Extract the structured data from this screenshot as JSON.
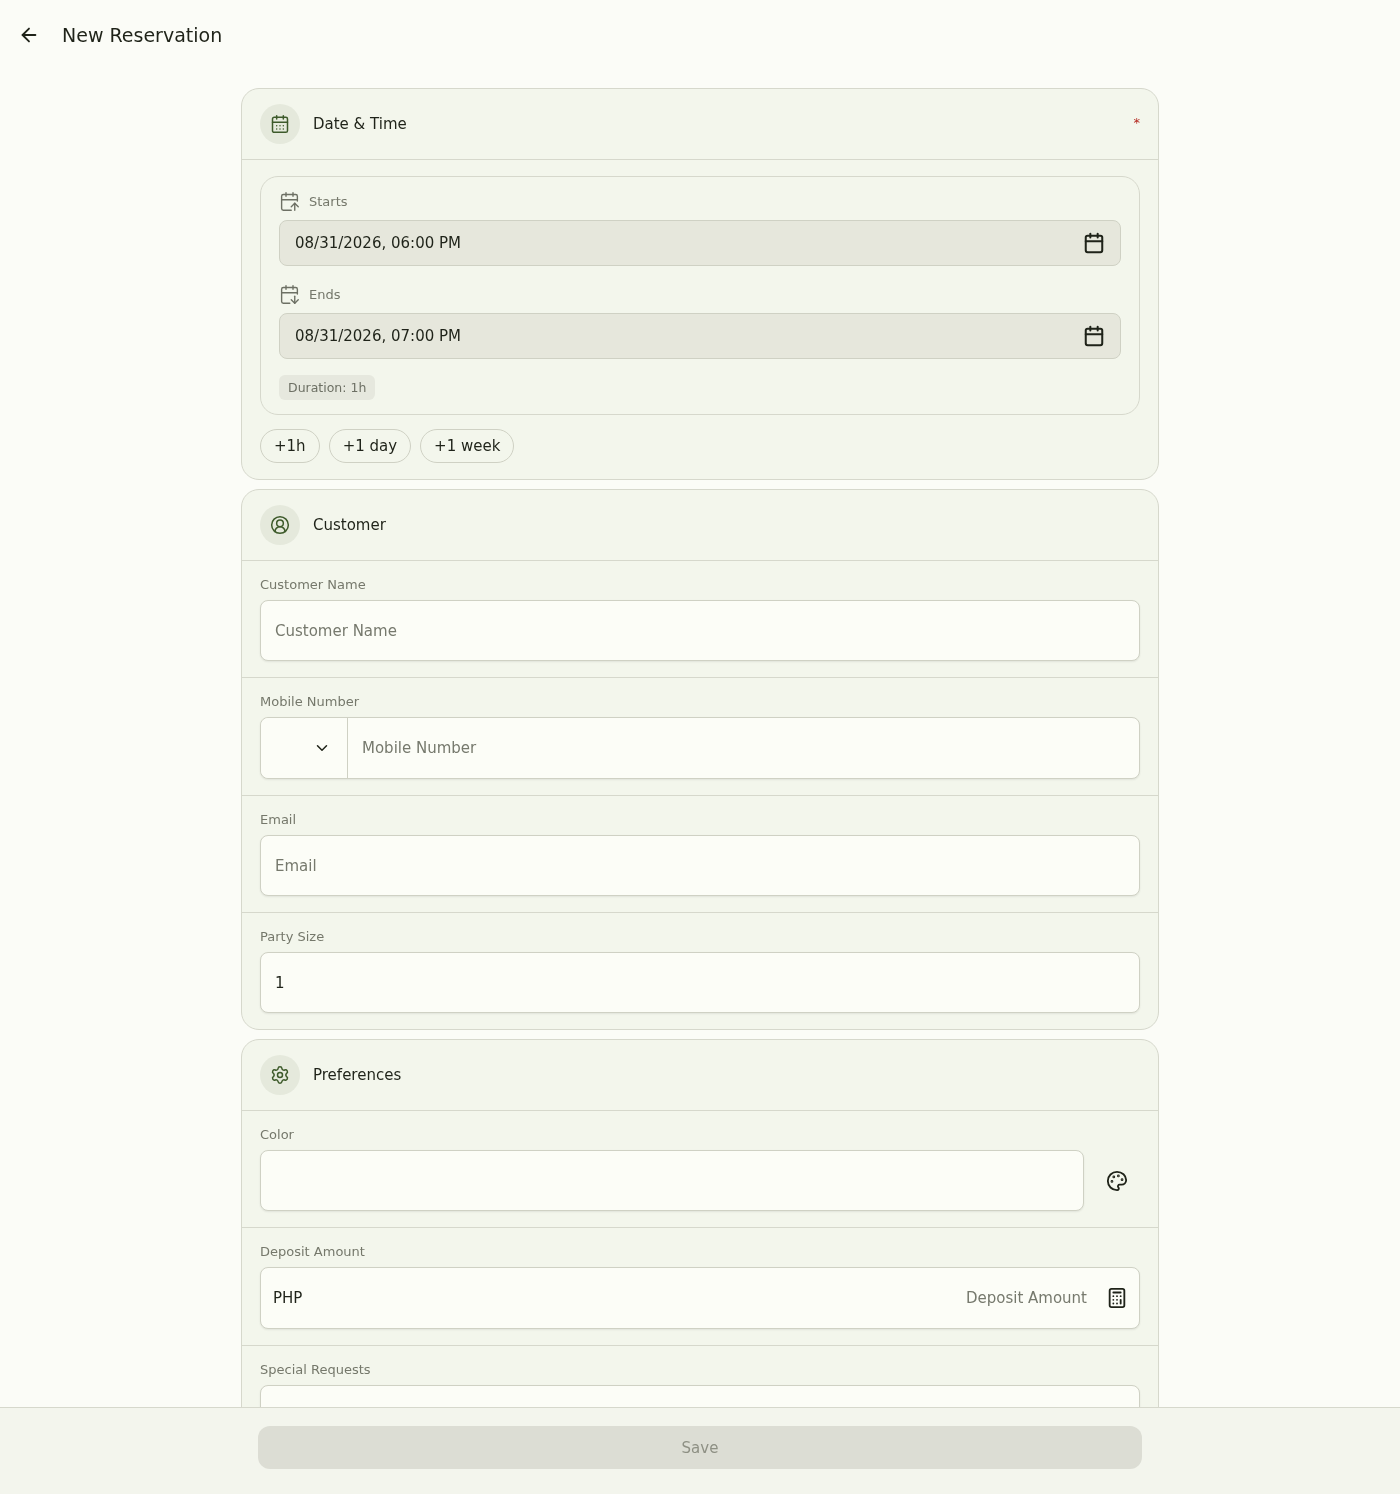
{
  "header": {
    "title": "New Reservation"
  },
  "sections": [
    {
      "kind": "datetime",
      "title": "Date & Time",
      "required_mark": "*",
      "starts": {
        "label": "Starts",
        "value": "08/31/2026, 06:00 PM"
      },
      "ends": {
        "label": "Ends",
        "value": "08/31/2026, 07:00 PM"
      },
      "duration": "Duration: 1h",
      "quick_buttons": [
        "+1h",
        "+1 day",
        "+1 week"
      ]
    },
    {
      "kind": "fields",
      "title": "Customer",
      "fields": [
        {
          "kind": "text",
          "label": "Customer Name",
          "placeholder": "Customer Name"
        },
        {
          "kind": "phone",
          "label": "Mobile Number",
          "placeholder": "Mobile Number"
        },
        {
          "kind": "text",
          "label": "Email",
          "placeholder": "Email"
        },
        {
          "kind": "text",
          "label": "Party Size",
          "value": "1"
        }
      ]
    },
    {
      "kind": "fields",
      "title": "Preferences",
      "fields": [
        {
          "kind": "color",
          "label": "Color"
        },
        {
          "kind": "currency",
          "label": "Deposit Amount",
          "prefix": "PHP",
          "placeholder": "Deposit Amount"
        },
        {
          "kind": "textarea",
          "label": "Special Requests"
        }
      ]
    }
  ],
  "footer": {
    "save": {
      "label": "Save",
      "disabled": true
    }
  }
}
